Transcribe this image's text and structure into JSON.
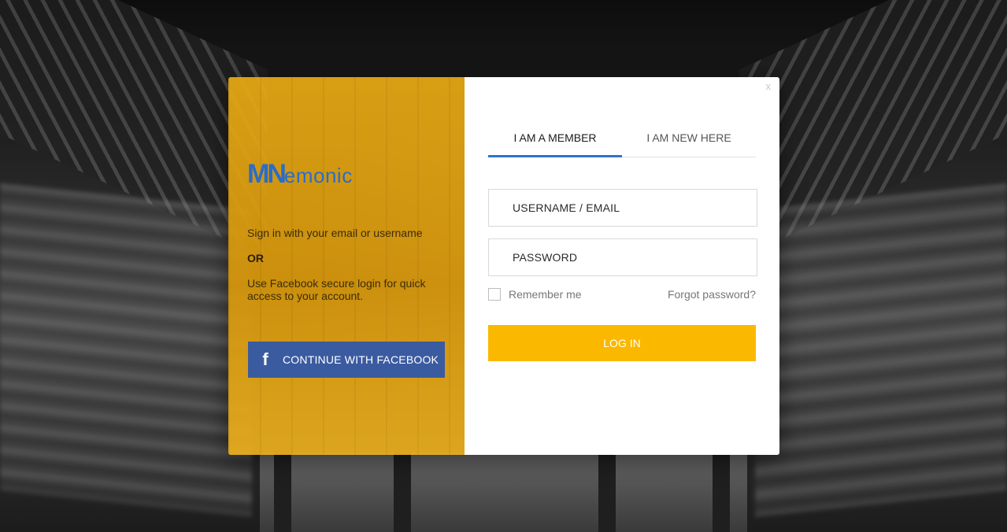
{
  "brand": {
    "logo_mn": "MN",
    "logo_rest": "emonic",
    "logo_color": "#2a6dc9"
  },
  "left_panel": {
    "intro_text": "Sign in with your email or username",
    "or_text": "OR",
    "facebook_text": "Use Facebook secure login for quick access to your account.",
    "facebook_button": {
      "icon": "facebook-icon",
      "icon_glyph": "f",
      "label": "CONTINUE WITH FACEBOOK",
      "color": "#3b5ba0"
    },
    "panel_color": "#e8aa14"
  },
  "right_panel": {
    "close_label": "x",
    "tabs": [
      {
        "label": "I AM A MEMBER",
        "active": true
      },
      {
        "label": "I AM NEW HERE",
        "active": false
      }
    ],
    "active_tab_color": "#2f73c9",
    "username_placeholder": "USERNAME / EMAIL",
    "password_placeholder": "PASSWORD",
    "remember_label": "Remember me",
    "remember_checked": false,
    "forgot_label": "Forgot password?",
    "login_label": "LOG IN",
    "login_color": "#fbb800"
  }
}
